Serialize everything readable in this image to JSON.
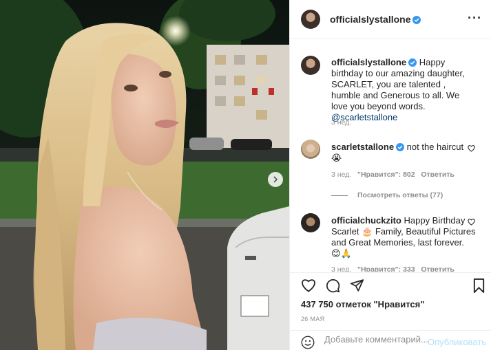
{
  "post": {
    "author": "officialslystallone",
    "more_icon": "more-dots-icon",
    "next_icon": "chevron-right-icon"
  },
  "caption": {
    "username": "officialslystallone",
    "text": "Happy birthday to our amazing daughter, SCARLET, you are talented , humble and Generous to all. We love you beyond words. ",
    "mention": "@scarletstallone",
    "age": "3 нед."
  },
  "comments": [
    {
      "username": "scarletstallone",
      "text": "not the haircut 😭",
      "age": "3 нед.",
      "likes_label": "\"Нравится\": 802",
      "reply_label": "Ответить",
      "view_replies": "Посмотреть ответы (77)"
    },
    {
      "username": "officialchuckzito",
      "text": "Happy Birthday Scarlet 🎂 Family, Beautiful Pictures and Great Memories, last forever. 😊🙏",
      "age": "3 нед.",
      "likes_label": "\"Нравится\": 333",
      "reply_label": "Ответить"
    }
  ],
  "actions": {
    "like_icon": "heart-icon",
    "comment_icon": "comment-icon",
    "share_icon": "send-icon",
    "save_icon": "bookmark-icon"
  },
  "likes_text": "437 750 отметок \"Нравится\"",
  "date_text": "26 МАЯ",
  "add_comment": {
    "emoji_icon": "smiley-icon",
    "placeholder": "Добавьте комментарий...",
    "publish_label": "Опубликовать"
  },
  "colors": {
    "verified": "#3897f0",
    "link": "#00376b",
    "publish": "#b2dffc",
    "muted": "#8e8e8e"
  }
}
